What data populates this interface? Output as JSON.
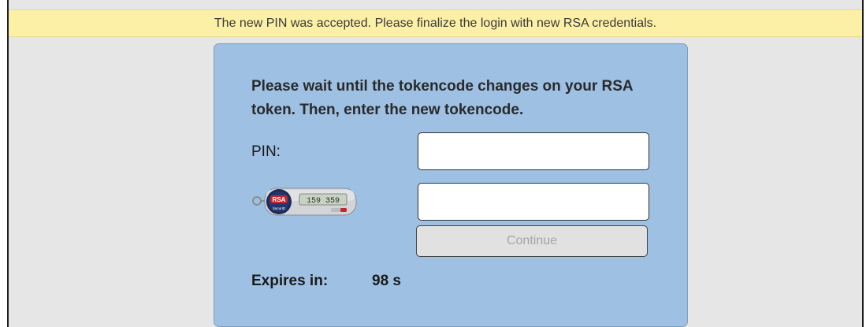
{
  "banner": {
    "message": "The new PIN was accepted. Please finalize the login with new RSA credentials."
  },
  "form": {
    "instructions": "Please wait until the tokencode changes on your RSA token. Then, enter the new tokencode.",
    "pin_label": "PIN:",
    "pin_value": "",
    "tokencode_value": "",
    "continue_label": "Continue",
    "expires_label": "Expires in:",
    "expires_value": "98 s"
  },
  "token_device": {
    "icon": "rsa-securid-token-icon",
    "logo_text": "RSA",
    "logo_subtext": "SecurID",
    "display_code": "159 359"
  },
  "colors": {
    "banner_bg": "#fcf0a6",
    "card_bg": "#9dc0e3",
    "page_bg": "#e6e6e6",
    "button_bg": "#e1e1e1"
  }
}
